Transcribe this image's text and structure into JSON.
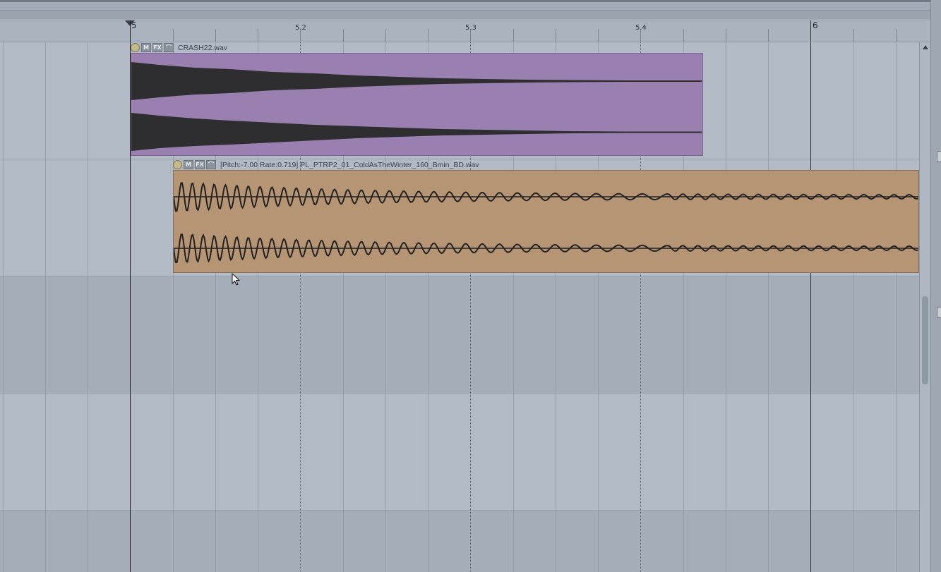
{
  "ruler": {
    "bar_start": "5",
    "bar_end": "6",
    "markers": [
      "5.2",
      "5.3",
      "5.4"
    ]
  },
  "tracks": [
    {
      "clip_name": "CRASH22.wav",
      "color": "#9a80b0",
      "buttons": [
        "M",
        "FX"
      ]
    },
    {
      "clip_name": "[Pitch:-7.00 Rate:0.719] PL_PTRP2_01_ColdAsTheWinter_160_Bmin_BD.wav",
      "color": "#b69574",
      "buttons": [
        "M",
        "FX"
      ]
    }
  ],
  "icons": {
    "clip_power": "power-icon",
    "clip_envelope": "envelope-icon",
    "pointer": "mouse-pointer-icon"
  }
}
